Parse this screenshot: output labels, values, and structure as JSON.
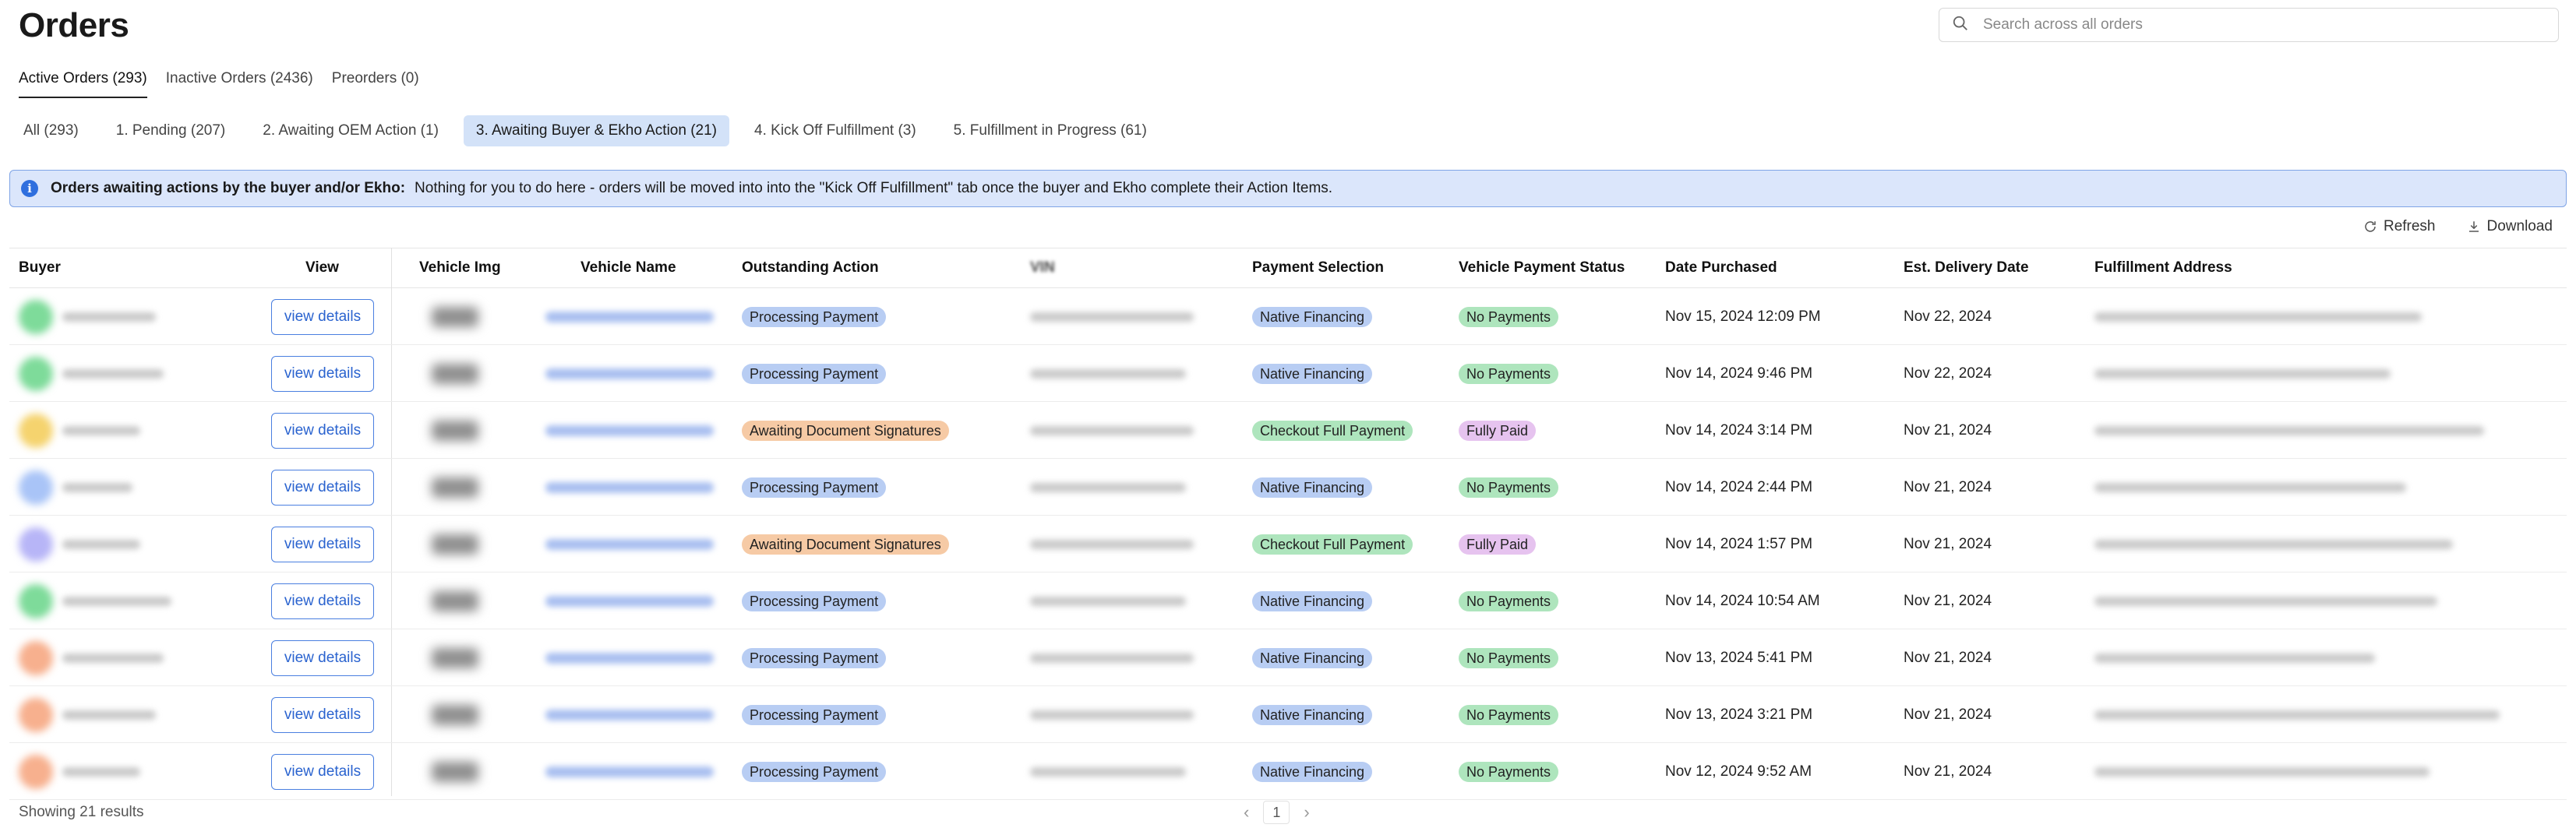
{
  "page": {
    "title": "Orders"
  },
  "search": {
    "placeholder": "Search across all orders"
  },
  "main_tabs": [
    {
      "label": "Active Orders (293)",
      "active": true
    },
    {
      "label": "Inactive Orders (2436)",
      "active": false
    },
    {
      "label": "Preorders (0)",
      "active": false
    }
  ],
  "sub_tabs": [
    {
      "label": "All (293)",
      "active": false
    },
    {
      "label": "1. Pending (207)",
      "active": false
    },
    {
      "label": "2. Awaiting OEM Action (1)",
      "active": false
    },
    {
      "label": "3. Awaiting Buyer & Ekho Action (21)",
      "active": true
    },
    {
      "label": "4. Kick Off Fulfillment (3)",
      "active": false
    },
    {
      "label": "5. Fulfillment in Progress (61)",
      "active": false
    }
  ],
  "banner": {
    "bold": "Orders awaiting actions by the buyer and/or Ekho:",
    "text": "Nothing for you to do here - orders will be moved into into the \"Kick Off Fulfillment\" tab once the buyer and Ekho complete their Action Items."
  },
  "toolbar": {
    "refresh_label": "Refresh",
    "download_label": "Download"
  },
  "table": {
    "headers": {
      "buyer": "Buyer",
      "view": "View",
      "vehicle_img": "Vehicle Img",
      "vehicle_name": "Vehicle Name",
      "outstanding_action": "Outstanding Action",
      "vin": "VIN",
      "payment_selection": "Payment Selection",
      "vehicle_payment_status": "Vehicle Payment Status",
      "date_purchased": "Date Purchased",
      "est_delivery_date": "Est. Delivery Date",
      "fulfillment_address": "Fulfillment Address"
    },
    "view_button_label": "view details",
    "rows": [
      {
        "action": "Processing Payment",
        "payment": "Native Financing",
        "status": "No Payments",
        "purchased": "Nov 15, 2024 12:09 PM",
        "delivery": "Nov 22, 2024"
      },
      {
        "action": "Processing Payment",
        "payment": "Native Financing",
        "status": "No Payments",
        "purchased": "Nov 14, 2024 9:46 PM",
        "delivery": "Nov 22, 2024"
      },
      {
        "action": "Awaiting Document Signatures",
        "payment": "Checkout Full Payment",
        "status": "Fully Paid",
        "purchased": "Nov 14, 2024 3:14 PM",
        "delivery": "Nov 21, 2024"
      },
      {
        "action": "Processing Payment",
        "payment": "Native Financing",
        "status": "No Payments",
        "purchased": "Nov 14, 2024 2:44 PM",
        "delivery": "Nov 21, 2024"
      },
      {
        "action": "Awaiting Document Signatures",
        "payment": "Checkout Full Payment",
        "status": "Fully Paid",
        "purchased": "Nov 14, 2024 1:57 PM",
        "delivery": "Nov 21, 2024"
      },
      {
        "action": "Processing Payment",
        "payment": "Native Financing",
        "status": "No Payments",
        "purchased": "Nov 14, 2024 10:54 AM",
        "delivery": "Nov 21, 2024"
      },
      {
        "action": "Processing Payment",
        "payment": "Native Financing",
        "status": "No Payments",
        "purchased": "Nov 13, 2024 5:41 PM",
        "delivery": "Nov 21, 2024"
      },
      {
        "action": "Processing Payment",
        "payment": "Native Financing",
        "status": "No Payments",
        "purchased": "Nov 13, 2024 3:21 PM",
        "delivery": "Nov 21, 2024"
      },
      {
        "action": "Processing Payment",
        "payment": "Native Financing",
        "status": "No Payments",
        "purchased": "Nov 12, 2024 9:52 AM",
        "delivery": "Nov 21, 2024"
      }
    ]
  },
  "footer": {
    "results_text": "Showing 21 results",
    "current_page": "1"
  },
  "colors": {
    "accent": "#2a63cf",
    "tab_active_bg": "#d3e2f8",
    "banner_bg": "#dbe6fb",
    "pill_blue": "#b8cdf3",
    "pill_orange": "#f6caa5",
    "pill_green": "#aee5bd",
    "pill_purple": "#e6c3ef"
  },
  "avatar_colors": [
    "#7edb9a",
    "#7edb9a",
    "#f5d36e",
    "#a9c4f7",
    "#b7b5f7",
    "#7edb9a",
    "#f7b08e",
    "#f7b08e",
    "#f7b08e"
  ]
}
